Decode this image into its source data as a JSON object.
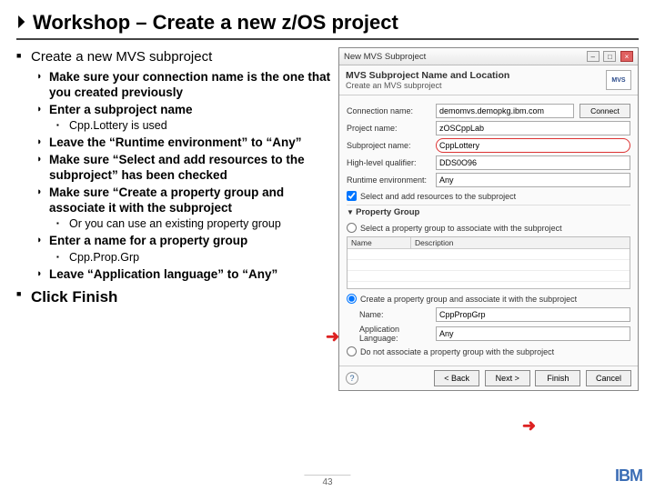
{
  "title": "Workshop – Create a new z/OS project",
  "outline": {
    "h1": "Create a new MVS subproject",
    "p1": "Make sure your connection name is the one that you created previously",
    "p2": "Enter a subproject name",
    "p2a": "Cpp.Lottery is used",
    "p3": "Leave the “Runtime environment” to “Any”",
    "p4": "Make sure “Select and add resources to the subproject” has been checked",
    "p5": "Make sure “Create a property group and associate it with the subproject",
    "p5a": "Or you can use an existing property group",
    "p6": "Enter a name for a property group",
    "p6a": "Cpp.Prop.Grp",
    "p7": "Leave “Application language” to “Any”",
    "h2": "Click Finish"
  },
  "dialog": {
    "winTitle": "New MVS Subproject",
    "hdrTitle": "MVS Subproject Name and Location",
    "hdrSub": "Create an MVS subproject",
    "mvsBadge": "MVS",
    "labels": {
      "conn": "Connection name:",
      "proj": "Project name:",
      "sub": "Subproject name:",
      "hlq": "High-level qualifier:",
      "rte": "Runtime environment:",
      "chkAdd": "Select and add resources to the subproject",
      "propHdr": "Property Group",
      "radioSelect": "Select a property group to associate with the subproject",
      "colName": "Name",
      "colDesc": "Description",
      "radioCreate": "Create a property group and associate it with the subproject",
      "name": "Name:",
      "lang": "Application Language:",
      "radioNone": "Do not associate a property group with the subproject"
    },
    "values": {
      "conn": "demomvs.demopkg.ibm.com",
      "proj": "zOSCppLab",
      "sub": "CppLottery",
      "hlq": "DDS0O96",
      "rte": "Any",
      "name": "CppPropGrp",
      "lang": "Any"
    },
    "buttons": {
      "connect": "Connect",
      "back": "< Back",
      "next": "Next >",
      "finish": "Finish",
      "cancel": "Cancel"
    }
  },
  "pageNum": "43",
  "logo": "IBM"
}
